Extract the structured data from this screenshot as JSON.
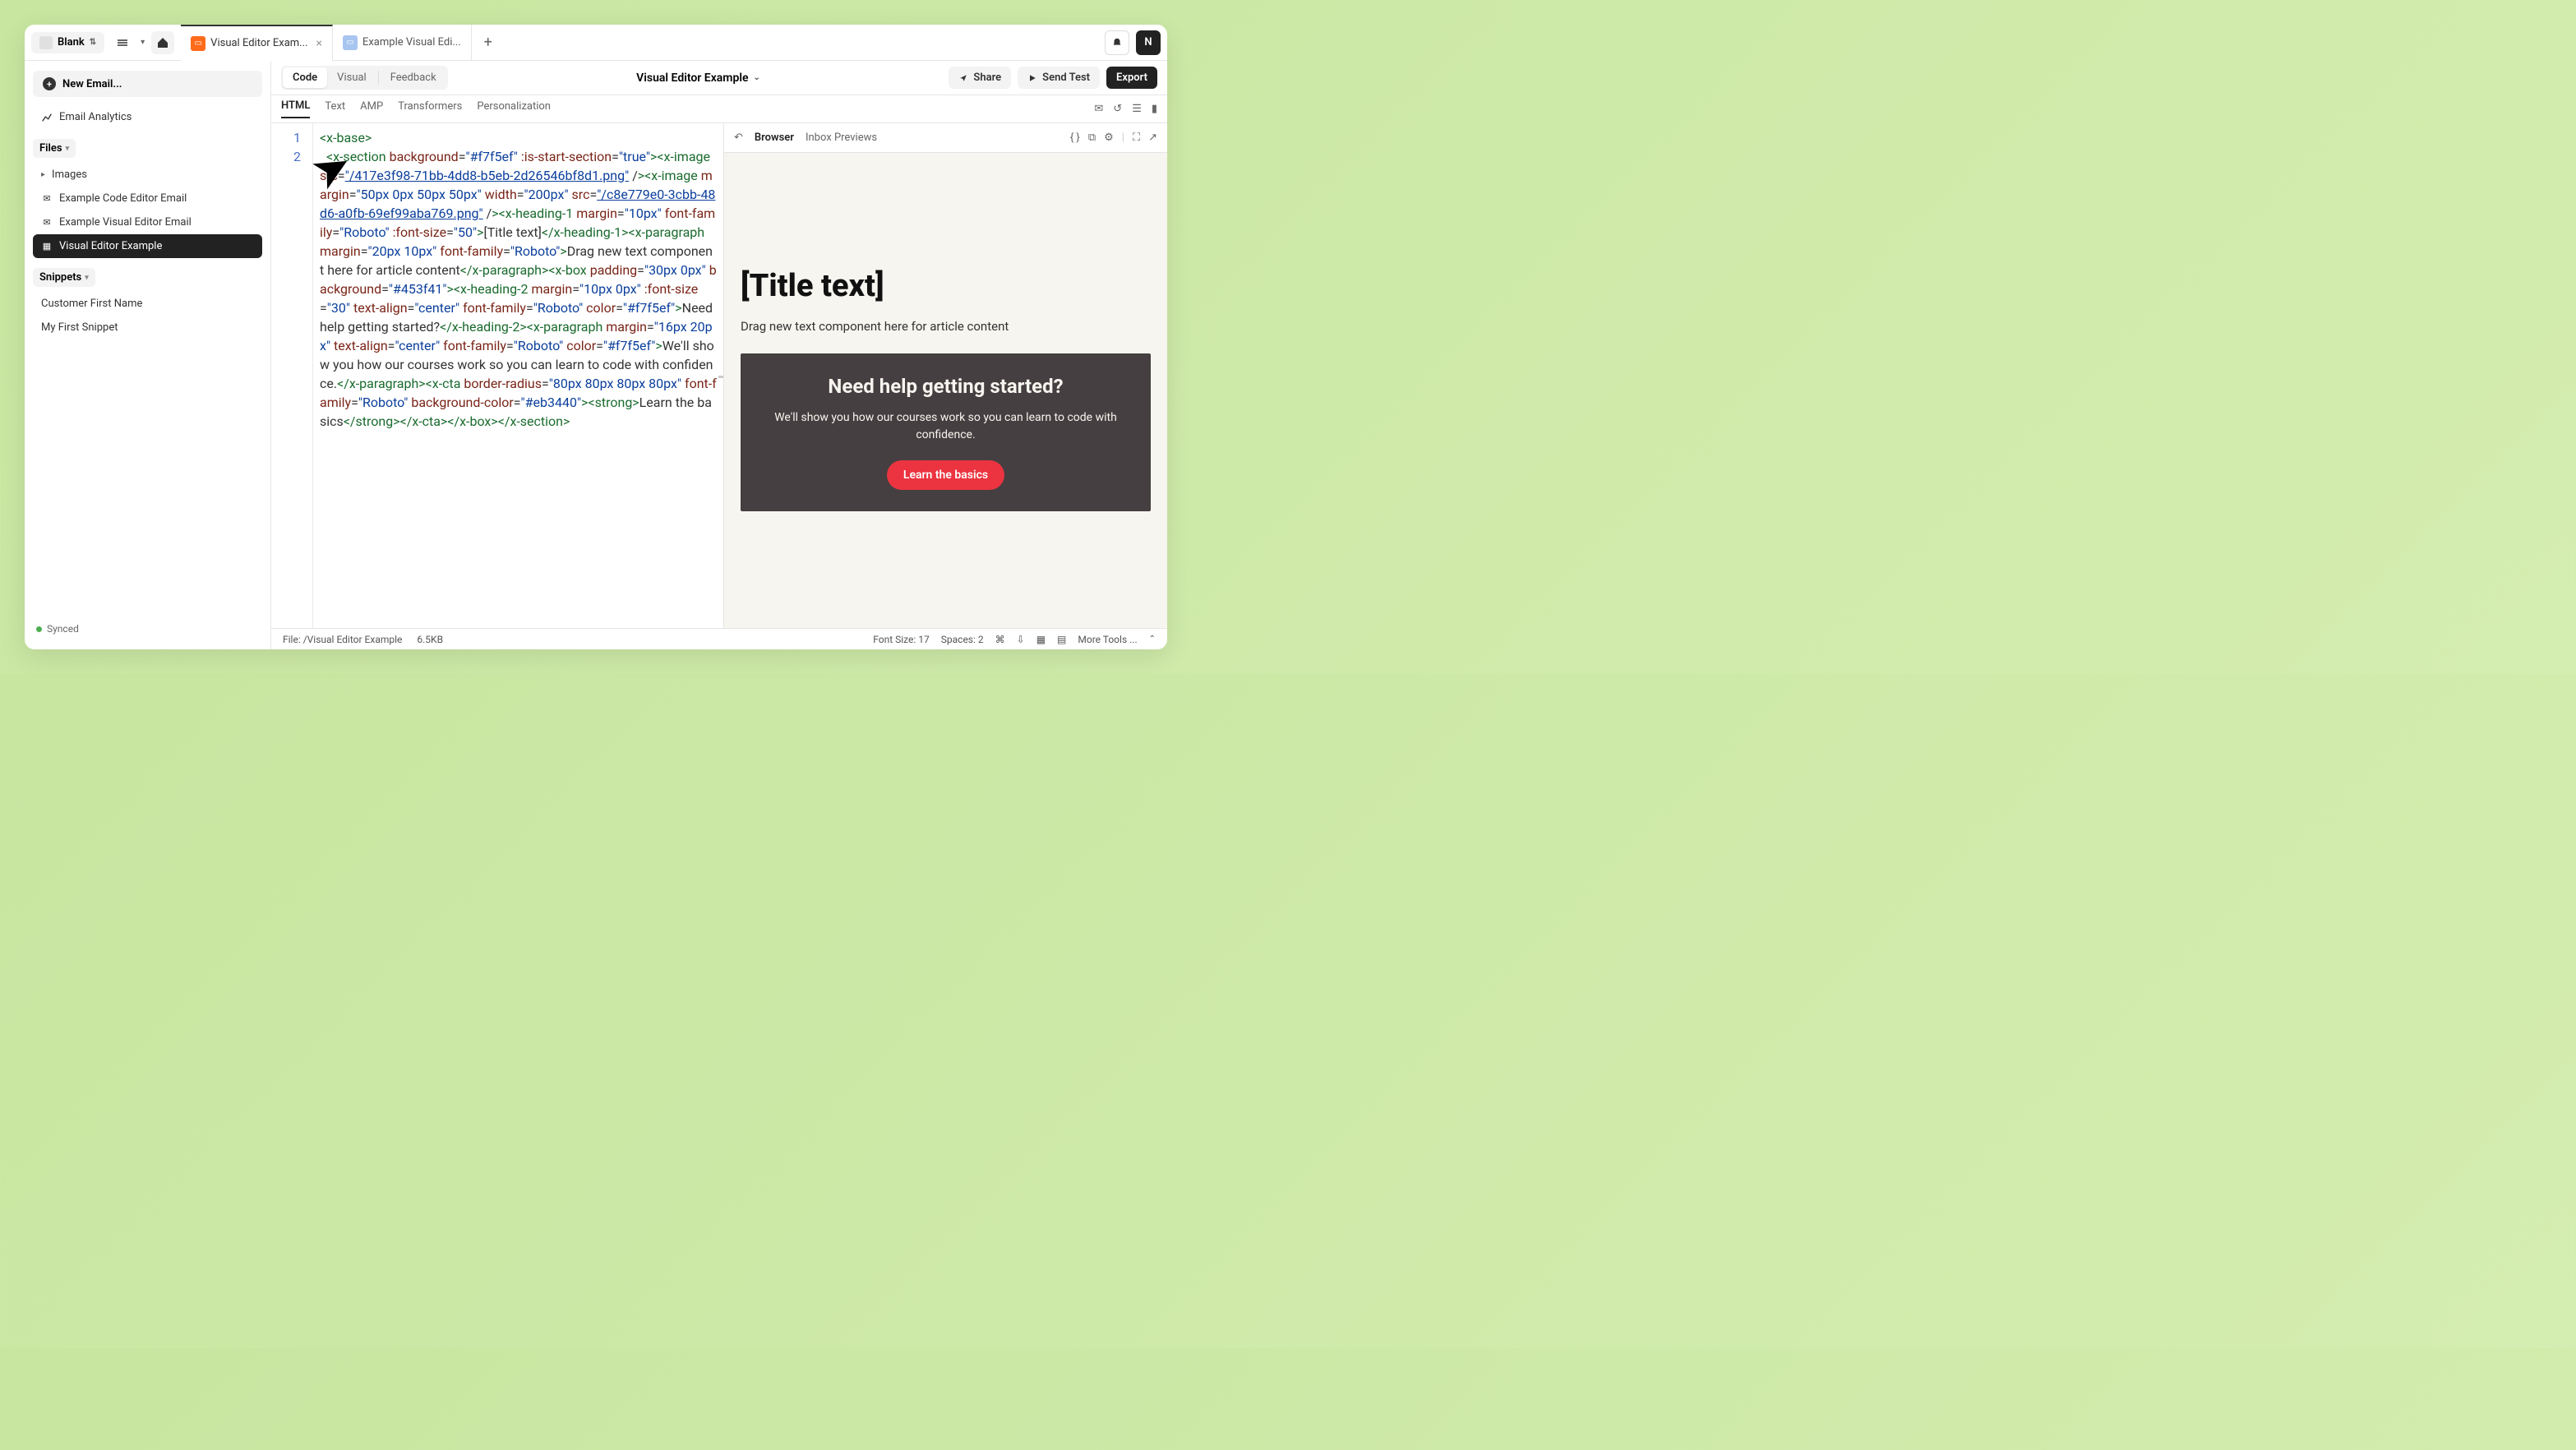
{
  "topbar": {
    "blank_label": "Blank",
    "tabs": [
      {
        "label": "Visual Editor Exam...",
        "active": true
      },
      {
        "label": "Example Visual Edi...",
        "active": false
      }
    ],
    "avatar_letter": "N"
  },
  "sidebar": {
    "new_email_label": "New Email...",
    "analytics_label": "Email Analytics",
    "files_label": "Files",
    "images_label": "Images",
    "file_list": [
      {
        "label": "Example Code Editor Email",
        "active": false
      },
      {
        "label": "Example Visual Editor Email",
        "active": false
      },
      {
        "label": "Visual Editor Example",
        "active": true
      }
    ],
    "snippets_label": "Snippets",
    "snippet_list": [
      {
        "label": "Customer First Name"
      },
      {
        "label": "My First Snippet"
      }
    ],
    "sync_label": "Synced"
  },
  "toolbar": {
    "mode_code": "Code",
    "mode_visual": "Visual",
    "mode_feedback": "Feedback",
    "title": "Visual Editor Example",
    "share": "Share",
    "send_test": "Send Test",
    "export": "Export"
  },
  "subtabs": {
    "html": "HTML",
    "text": "Text",
    "amp": "AMP",
    "transformers": "Transformers",
    "personalization": "Personalization"
  },
  "preview_bar": {
    "browser": "Browser",
    "inbox": "Inbox Previews"
  },
  "preview": {
    "title": "[Title text]",
    "paragraph": "Drag new text component here for article content",
    "help_heading": "Need help getting started?",
    "help_text": "We'll show you how our courses work so you can learn to code with confidence.",
    "cta": "Learn the basics"
  },
  "statusbar": {
    "file_label": "File: /Visual Editor Example",
    "size": "6.5KB",
    "font_size": "Font Size: 17",
    "spaces": "Spaces: 2",
    "cmd": "⌘",
    "more_tools": "More Tools ..."
  },
  "code": {
    "line1": "1",
    "line2": "2",
    "bg1": "\"#f7f5ef\"",
    "true": "\"true\"",
    "src": "src",
    "img1a": "\"/",
    "img1b": "417e3f98-71bb-4dd8-b5eb-2d26546bf8d1.png\"",
    "margin50": "\"50px 0px 50px 50px\"",
    "width200": "\"200px\"",
    "img2a": "\"/",
    "img2b": "c8e779e0-3cbb-48d6-a0fb-69ef99aba769.png\"",
    "margin10": "\"10px\"",
    "roboto": "\"Roboto\"",
    "fs50": "\"50\"",
    "title_text": "[Title text]",
    "margin20_10": "\"20px 10px\"",
    "drag_text": "Drag new text component here for article content",
    "pad30": "\"30px 0px\"",
    "bg45": "\"#453f41\"",
    "margin10_0": "\"10px 0px\"",
    "fs30": "\"30\"",
    "center": "\"center\"",
    "help_q": "Need help getting started?",
    "margin16_20": "\"16px 20px\"",
    "help_t": "We'll show you how our courses work so you can learn to code with confidence.",
    "br80": "\"80px 80px 80px 80px\"",
    "eb": "\"#eb3440\"",
    "learn": "Learn the basics"
  }
}
